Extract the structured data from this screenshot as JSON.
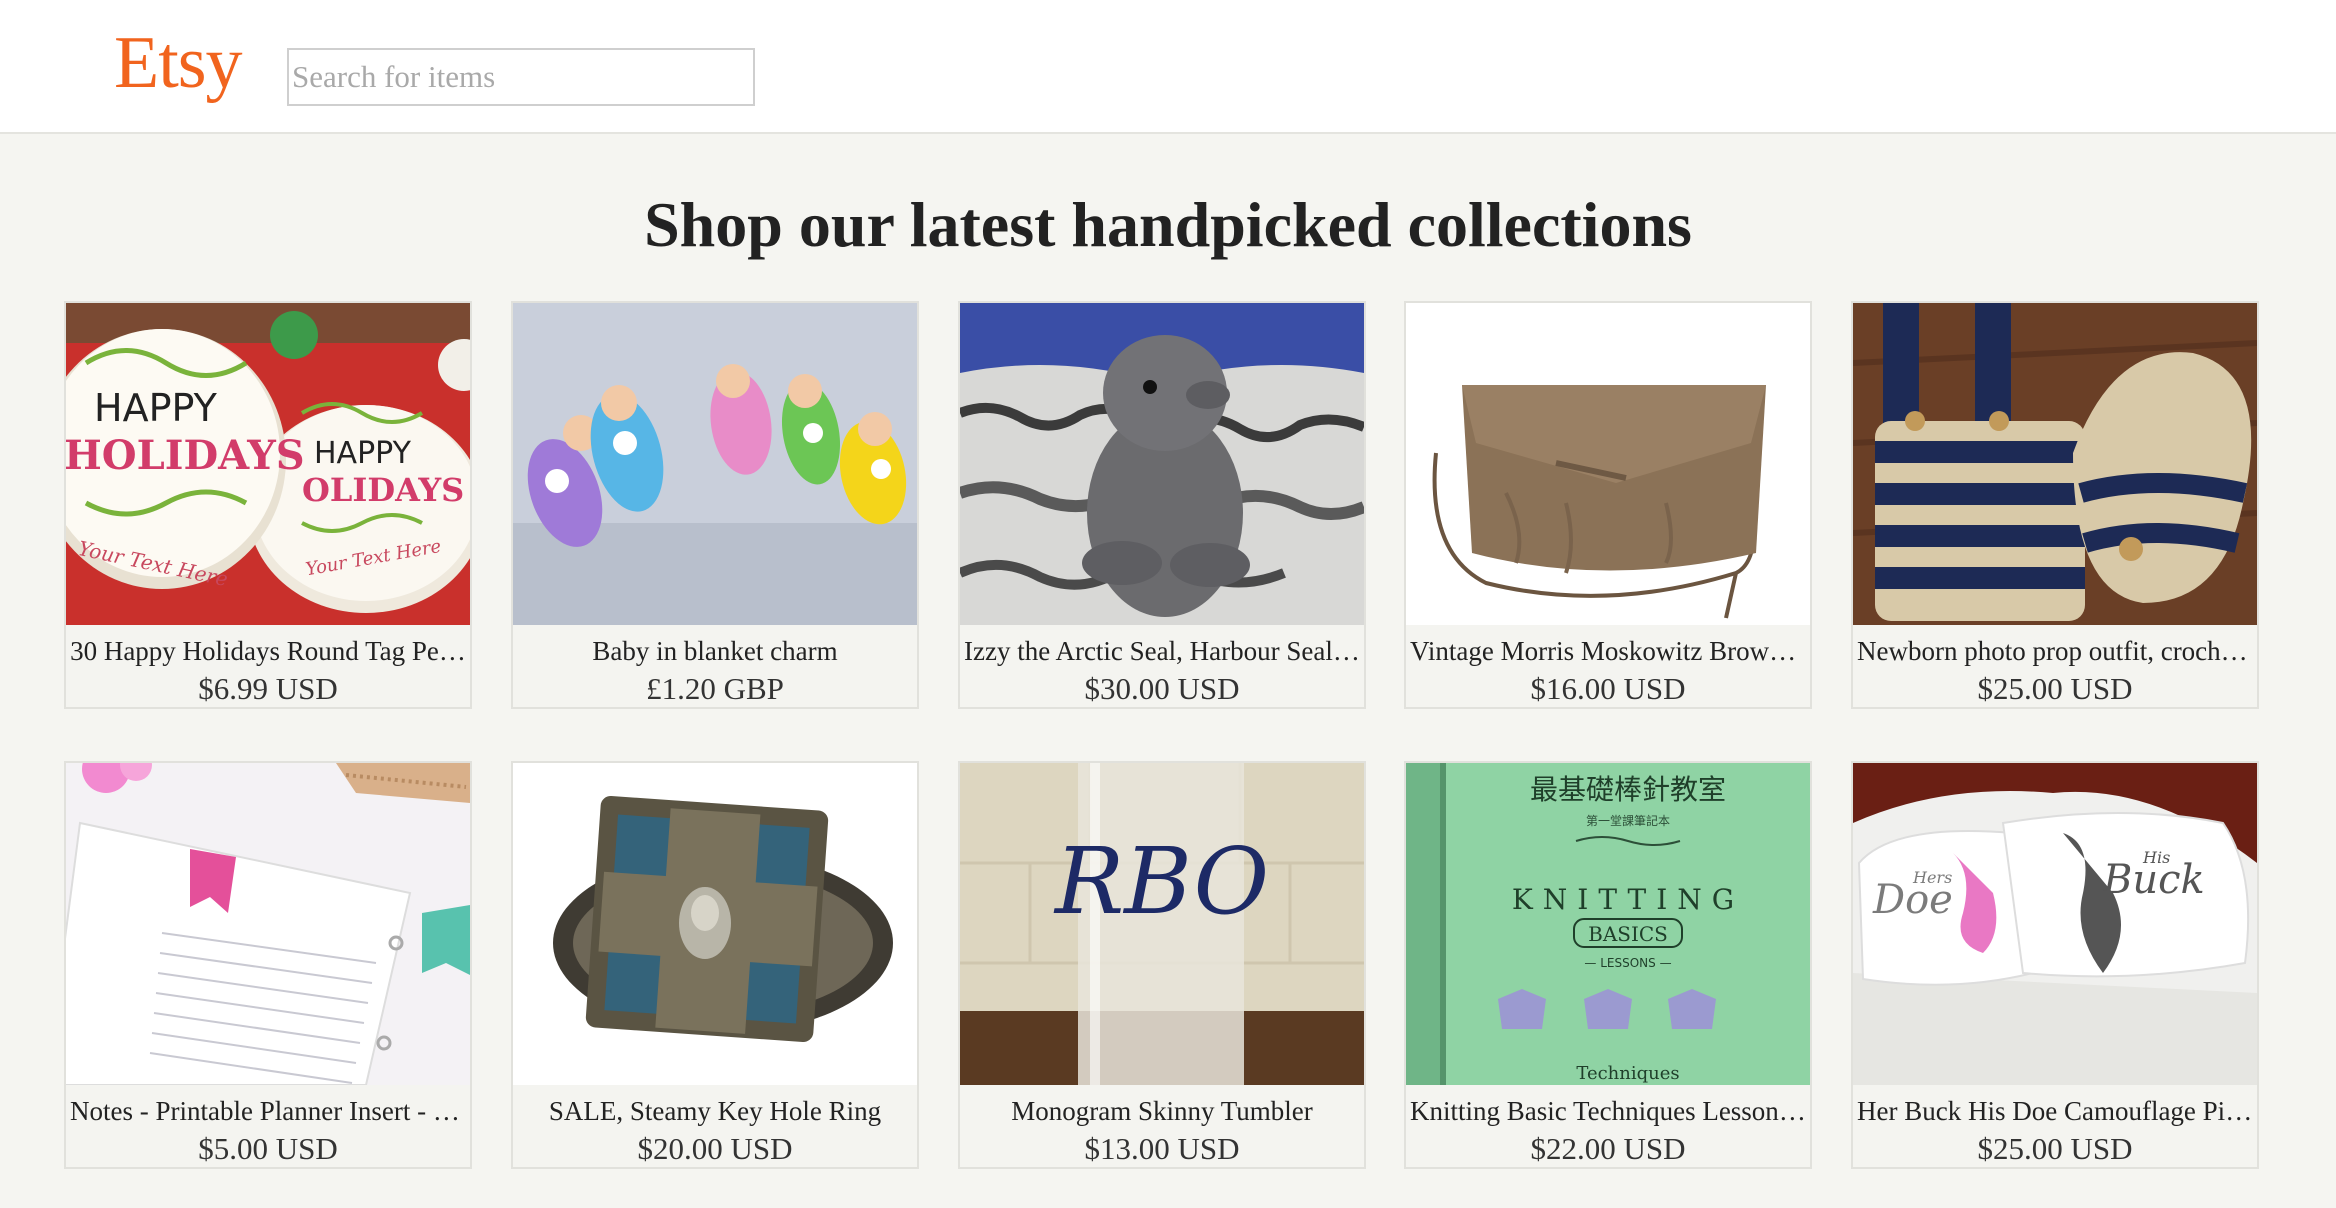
{
  "header": {
    "logo": "Etsy",
    "search_placeholder": "Search for items"
  },
  "main": {
    "heading": "Shop our latest handpicked collections",
    "listings": [
      {
        "title": "30 Happy Holidays Round Tag Pe…",
        "price": "$6.99 USD",
        "image": "happy-holidays-tags-image"
      },
      {
        "title": "Baby in blanket charm",
        "price": "£1.20 GBP",
        "image": "baby-blanket-charms-image"
      },
      {
        "title": "Izzy the Arctic Seal, Harbour Seal,…",
        "price": "$30.00 USD",
        "image": "plush-seal-image"
      },
      {
        "title": "Vintage Morris Moskowitz Brown…",
        "price": "$16.00 USD",
        "image": "brown-leather-clutch-image"
      },
      {
        "title": "Newborn photo prop outfit, croche…",
        "price": "$25.00 USD",
        "image": "crochet-outfit-image"
      },
      {
        "title": "Notes - Printable Planner Insert - 8…",
        "price": "$5.00 USD",
        "image": "planner-insert-image"
      },
      {
        "title": "SALE, Steamy Key Hole Ring",
        "price": "$20.00 USD",
        "image": "keyhole-ring-image"
      },
      {
        "title": "Monogram Skinny Tumbler",
        "price": "$13.00 USD",
        "image": "monogram-tumbler-image"
      },
      {
        "title": "Knitting Basic Techniques Lesson …",
        "price": "$22.00 USD",
        "image": "knitting-book-image"
      },
      {
        "title": "Her Buck His Doe Camouflage Pil…",
        "price": "$25.00 USD",
        "image": "pillowcases-image"
      }
    ],
    "image_text": {
      "happy": "HAPPY",
      "holidays": "HOLIDAYS",
      "holidays_partial": "OLIDAYS",
      "your_text_here": "Your Text Here",
      "monogram": "RBO",
      "book_cjk_title": "最基礎棒針教室",
      "book_cjk_subtitle": "第一堂課筆記本",
      "book_knitting": "KNITTING",
      "book_basics": "BASICS",
      "book_lessons": "— LESSONS —",
      "book_techniques": "Techniques",
      "pillow_doe": "Doe",
      "pillow_buck": "Buck",
      "pillow_his": "His",
      "pillow_hers": "Hers"
    }
  }
}
